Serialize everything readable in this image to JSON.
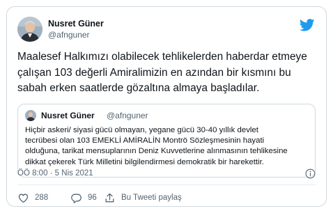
{
  "author": {
    "name": "Nusret Güner",
    "handle": "@afnguner"
  },
  "tweet": {
    "text": "Maalesef Halkımızı olabilecek tehlikelerden haberdar etmeye\nçalışan 103 değerli Amiralimizin en azından bir kısmını bu\nsabah erken saatlerde gözaltına almaya başladılar."
  },
  "quote": {
    "name": "Nusret Güner",
    "handle": "@afnguner",
    "text": "Hiçbir askeri/ siyasi gücü olmayan, yegane gücü 30-40 yıllık devlet\ntecrübesi olan 103 EMEKLİ AMİRALİN Montrö Sözleşmesinin hayati\nolduğuna, tarikat mensuplarının Deniz Kuvvetlerine alınmasının tehlikesine\ndikkat çekerek Türk Milletini bilgilendirmesi demokratik bir harekettir."
  },
  "timestamp": "ÖÖ 8:00 · 5 Nis 2021",
  "actions": {
    "likes": "288",
    "replies": "96",
    "share_label": "Bu Tweeti paylaş"
  },
  "colors": {
    "twitter_blue": "#1d9bf0",
    "secondary_text": "#536471",
    "border": "#cfd9de"
  }
}
